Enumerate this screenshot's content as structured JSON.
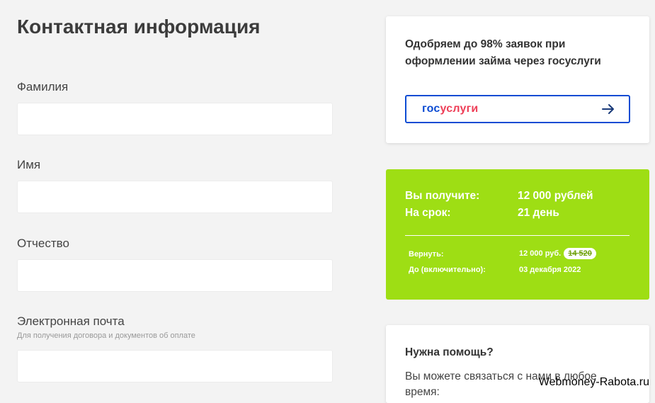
{
  "form": {
    "title": "Контактная информация",
    "fields": [
      {
        "label": "Фамилия",
        "value": ""
      },
      {
        "label": "Имя",
        "value": ""
      },
      {
        "label": "Отчество",
        "value": ""
      },
      {
        "label": "Электронная почта",
        "hint": "Для получения договора и документов об оплате",
        "value": ""
      }
    ]
  },
  "gosuslugi_card": {
    "text": "Одобряем до 98% заявок при оформлении займа через госуслуги",
    "logo_part1": "гос",
    "logo_part2": "услуги",
    "arrow_icon": "arrow-right-icon",
    "brand_blue": "#0d4cd3",
    "brand_red": "#ee3f58"
  },
  "loan_summary": {
    "receive_label": "Вы получите:",
    "receive_value": "12 000 рублей",
    "term_label": "На срок:",
    "term_value": "21 день",
    "return_label": "Вернуть:",
    "return_value": "12 000 руб.",
    "return_old_value": "14 520",
    "due_label": "До (включительно):",
    "due_value": "03 декабря 2022",
    "bg_color": "#9ede14"
  },
  "help": {
    "title": "Нужна помощь?",
    "text": "Вы можете связаться с нами в любое время:"
  },
  "watermark": "Webmoney-Rabota.ru"
}
